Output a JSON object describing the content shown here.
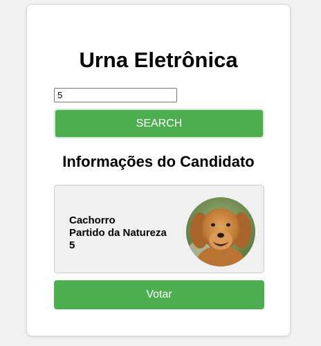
{
  "page": {
    "title": "Urna Eletrônica"
  },
  "search": {
    "input_value": "5",
    "button_label": "SEARCH"
  },
  "candidate": {
    "section_title": "Informações do Candidato",
    "name": "Cachorro",
    "party": "Partido da Natureza",
    "number": "5",
    "photo_icon": "dog-photo"
  },
  "actions": {
    "vote_label": "Votar"
  },
  "colors": {
    "accent_green": "#4cae4f",
    "card_background": "#ffffff",
    "info_box_background": "#f0f0f0"
  }
}
